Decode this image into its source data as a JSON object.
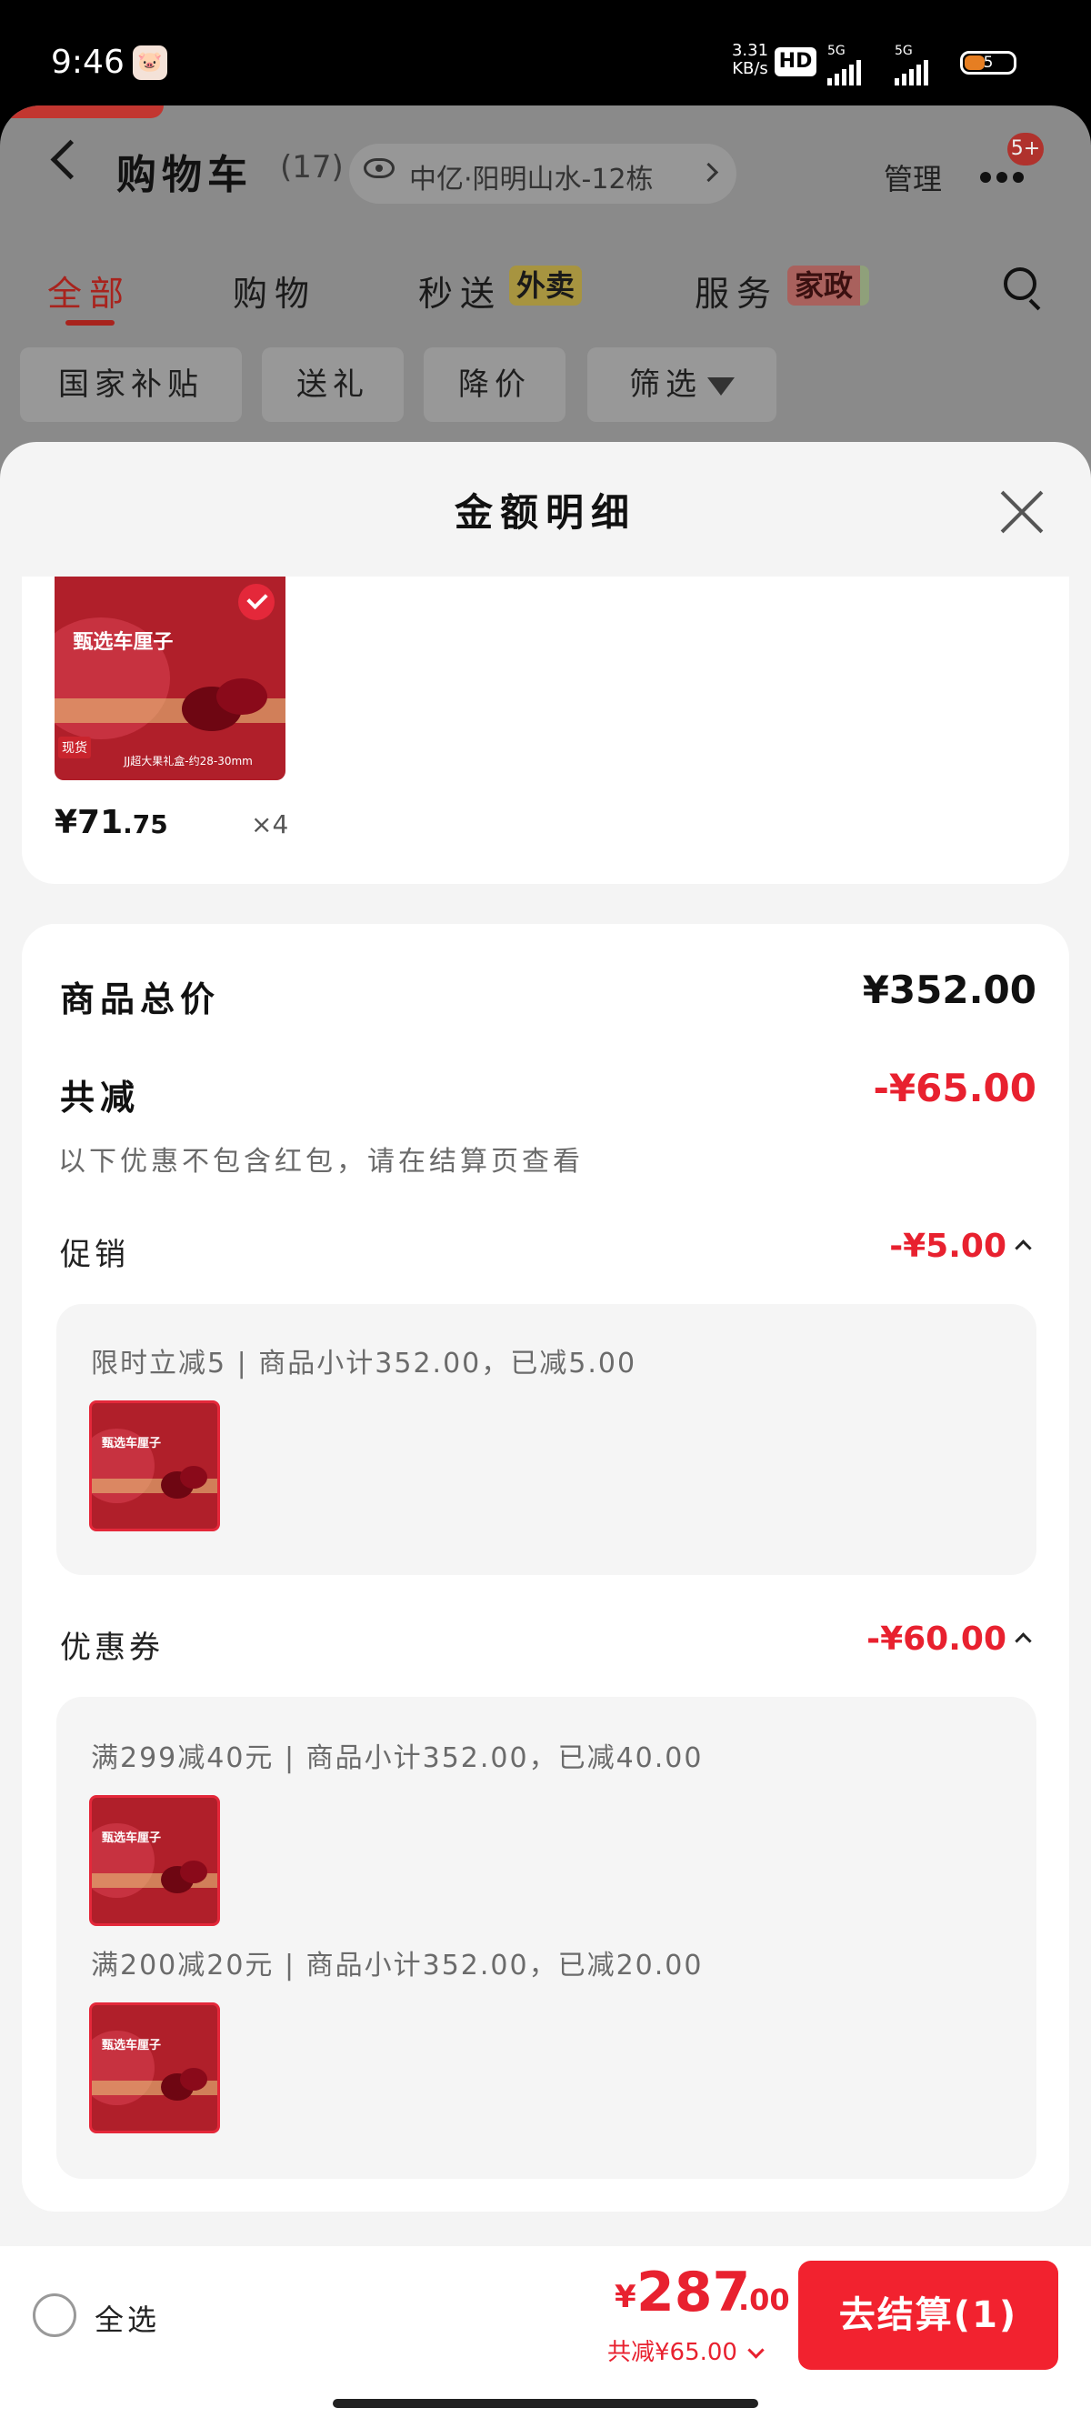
{
  "status_bar": {
    "time": "9:46",
    "net_speed_value": "3.31",
    "net_speed_unit": "KB/s",
    "hd_label": "HD",
    "signal1_label": "5G",
    "signal2_label": "5G",
    "battery": "5"
  },
  "cart_page": {
    "title": "购物车",
    "count": "(17)",
    "address": "中亿·阳明山水-12栋",
    "manage_label": "管理",
    "message_badge": "5+",
    "tabs": [
      {
        "label": "全部"
      },
      {
        "label": "购物"
      },
      {
        "label": "秒送",
        "tag": "外卖"
      },
      {
        "label": "服务",
        "tag": "家政"
      }
    ],
    "chips": [
      "国家补贴",
      "送礼",
      "降价",
      "筛选"
    ]
  },
  "sheet": {
    "title": "金额明细",
    "product": {
      "price_int": "¥71",
      "price_dec": ".75",
      "quantity": "×4",
      "image_name": "甄选车厘子",
      "image_sub": "JJ超大果礼盒-约28-30mm",
      "image_tag": "现货"
    },
    "summary": {
      "total_label": "商品总价",
      "total_value": "¥352.00",
      "reduce_label": "共减",
      "reduce_value": "-¥65.00",
      "hint": "以下优惠不包含红包，请在结算页查看"
    },
    "promotion": {
      "label": "促销",
      "value": "-¥5.00",
      "items": [
        "限时立减5 | 商品小计352.00，已减5.00"
      ]
    },
    "coupon": {
      "label": "优惠券",
      "value": "-¥60.00",
      "items": [
        "满299减40元 | 商品小计352.00，已减40.00",
        "满200减20元 | 商品小计352.00，已减20.00"
      ]
    }
  },
  "bottom_bar": {
    "select_all_label": "全选",
    "total_yen": "¥",
    "total_int": "287",
    "total_dec": ".00",
    "total_reduce": "共减¥65.00",
    "checkout_label": "去结算(1)"
  }
}
